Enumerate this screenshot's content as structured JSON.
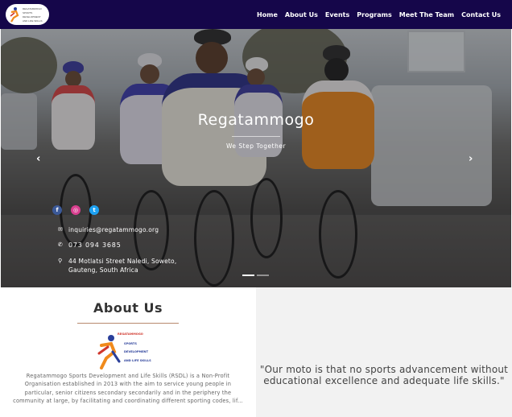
{
  "brand": {
    "logo_lines": [
      "REGATAMMOGO",
      "SPORTS",
      "DEVELOPMENT",
      "AND LIFE SKILLS"
    ]
  },
  "nav": {
    "items": [
      {
        "label": "Home"
      },
      {
        "label": "About Us"
      },
      {
        "label": "Events"
      },
      {
        "label": "Programs"
      },
      {
        "label": "Meet The Team"
      },
      {
        "label": "Contact Us"
      }
    ]
  },
  "hero": {
    "title": "Regatammogo",
    "subtitle": "We Step Together",
    "prev_arrow": "‹",
    "next_arrow": "›",
    "slide_count": 2,
    "active_slide": 1,
    "social": [
      {
        "name": "facebook-icon",
        "glyph": "f"
      },
      {
        "name": "instagram-icon",
        "glyph": "◎"
      },
      {
        "name": "twitter-icon",
        "glyph": "t"
      }
    ],
    "email": "inquiries@regatammogo.org",
    "phone": "073 094 3685",
    "address_line1": "44 Motlatsi Street Naledi, Soweto,",
    "address_line2": "Gauteng, South Africa"
  },
  "about": {
    "title": "About Us",
    "text": "Regatammogo Sports Development and Life Skills (RSDL) is a Non-Profit Organisation established in 2013 with the aim to service young people in particular, senior citizens secondary secondarily and in the periphery the community at large, by facilitating and coordinating different sporting codes, lif..."
  },
  "quote": {
    "text": "\"Our moto is that no sports advancement without educational excellence and adequate life skills.\""
  },
  "colors": {
    "navbar": "#15064a",
    "accent_orange": "#f08a1c",
    "accent_blue": "#2a3f9a"
  }
}
